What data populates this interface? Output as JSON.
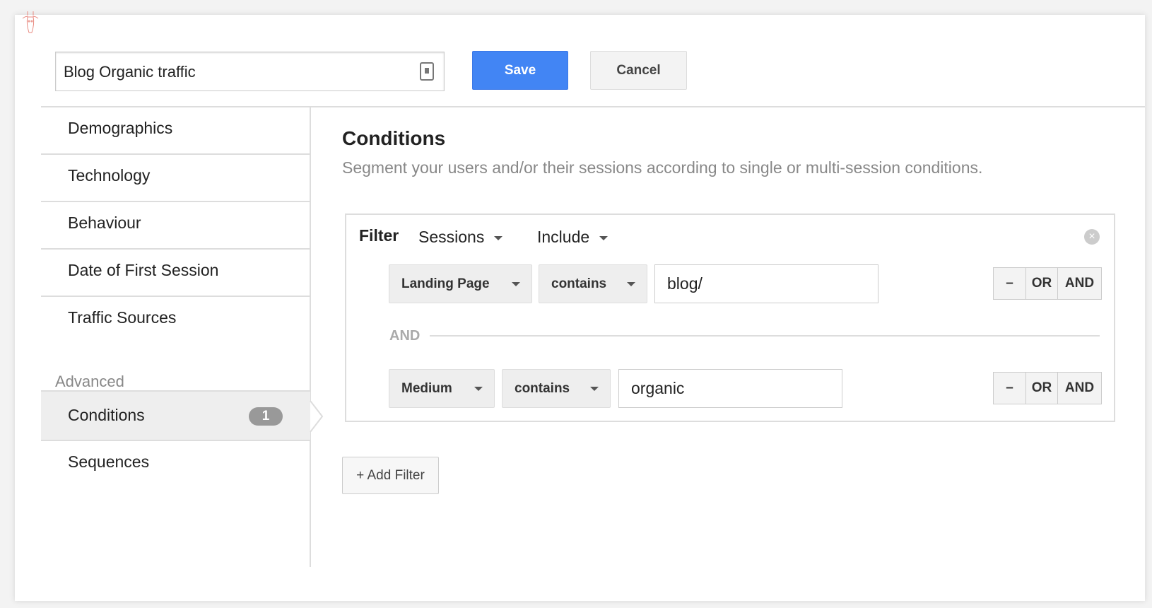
{
  "segment_name": "Blog Organic traffic",
  "toolbar": {
    "save_label": "Save",
    "cancel_label": "Cancel"
  },
  "sidebar": {
    "items": [
      {
        "label": "Demographics"
      },
      {
        "label": "Technology"
      },
      {
        "label": "Behaviour"
      },
      {
        "label": "Date of First Session"
      },
      {
        "label": "Traffic Sources"
      }
    ],
    "advanced_label": "Advanced",
    "advanced_items": [
      {
        "label": "Conditions",
        "badge": "1",
        "active": true
      },
      {
        "label": "Sequences"
      }
    ]
  },
  "main": {
    "title": "Conditions",
    "subtitle": "Segment your users and/or their sessions according to single or multi-session conditions.",
    "filter": {
      "label": "Filter",
      "scope": "Sessions",
      "mode": "Include",
      "rows": [
        {
          "dimension": "Landing Page",
          "operator": "contains",
          "value": "blog/"
        },
        {
          "dimension": "Medium",
          "operator": "contains",
          "value": "organic"
        }
      ],
      "joiner": "AND",
      "row_buttons": {
        "remove": "–",
        "or": "OR",
        "and": "AND"
      }
    },
    "add_filter_label": "+ Add Filter"
  },
  "colors": {
    "primary": "#4285f4",
    "logo": "#e88a80"
  }
}
